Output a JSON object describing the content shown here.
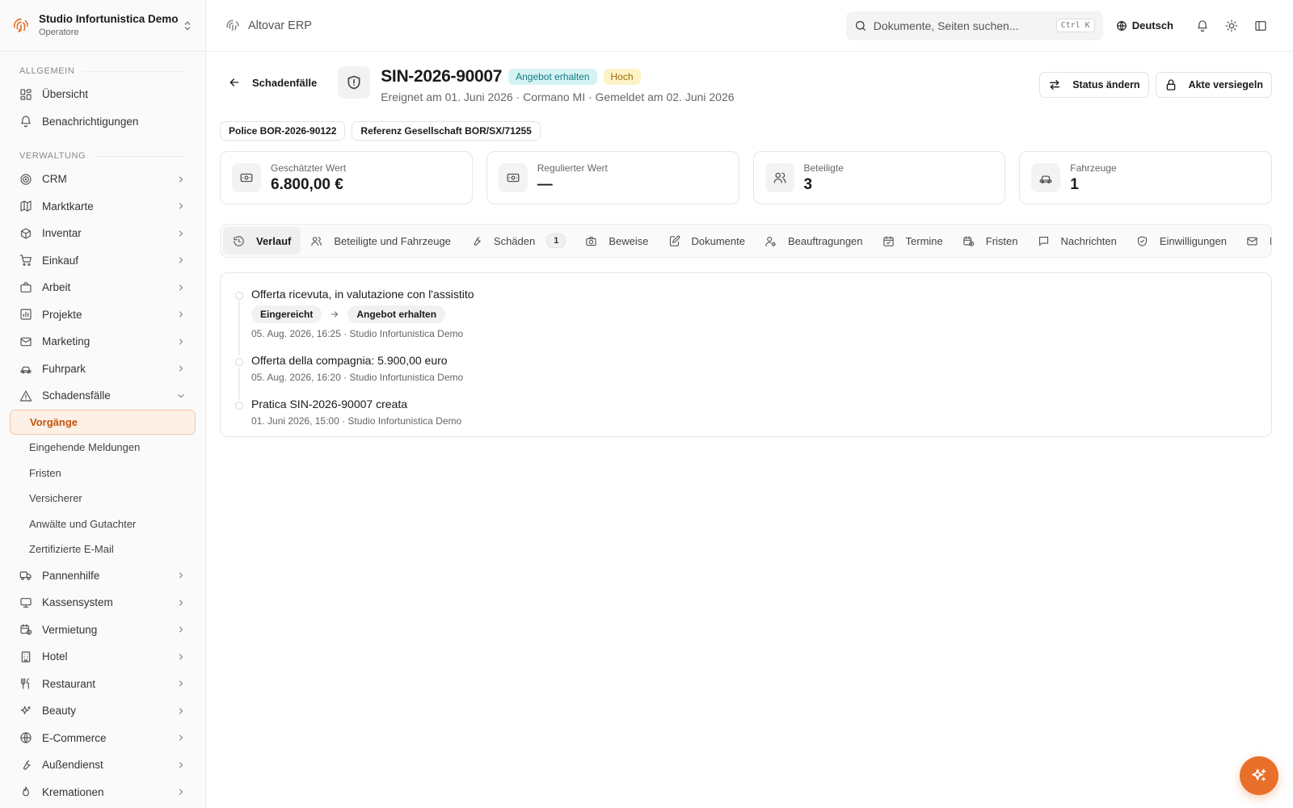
{
  "org": {
    "name": "Studio Infortunistica Demo",
    "role": "Operatore"
  },
  "sidebar": {
    "section_general": "ALLGEMEIN",
    "section_admin": "VERWALTUNG",
    "general_items": [
      {
        "label": "Übersicht",
        "icon": "dashboard-icon"
      },
      {
        "label": "Benachrichtigungen",
        "icon": "bell-icon"
      }
    ],
    "admin_items_top": [
      {
        "label": "CRM",
        "icon": "target-icon"
      },
      {
        "label": "Marktkarte",
        "icon": "map-icon"
      },
      {
        "label": "Inventar",
        "icon": "box-icon"
      },
      {
        "label": "Einkauf",
        "icon": "cart-icon"
      },
      {
        "label": "Arbeit",
        "icon": "briefcase-icon"
      },
      {
        "label": "Projekte",
        "icon": "chart-icon"
      },
      {
        "label": "Marketing",
        "icon": "mail-icon"
      },
      {
        "label": "Fuhrpark",
        "icon": "car-icon"
      }
    ],
    "claims": {
      "label": "Schadensfälle",
      "icon": "warning-icon"
    },
    "claims_sub": [
      "Vorgänge",
      "Eingehende Meldungen",
      "Fristen",
      "Versicherer",
      "Anwälte und Gutachter",
      "Zertifizierte E-Mail"
    ],
    "admin_items_bottom": [
      {
        "label": "Pannenhilfe",
        "icon": "truck-icon"
      },
      {
        "label": "Kassensystem",
        "icon": "monitor-icon"
      },
      {
        "label": "Vermietung",
        "icon": "calendar-clock-icon"
      },
      {
        "label": "Hotel",
        "icon": "building-icon"
      },
      {
        "label": "Restaurant",
        "icon": "utensils-icon"
      },
      {
        "label": "Beauty",
        "icon": "sparkle-icon"
      },
      {
        "label": "E-Commerce",
        "icon": "globe-icon"
      },
      {
        "label": "Außendienst",
        "icon": "wrench-icon"
      },
      {
        "label": "Kremationen",
        "icon": "flame-icon"
      }
    ]
  },
  "topbar": {
    "brand": "Altovar ERP",
    "search_placeholder": "Dokumente, Seiten suchen...",
    "search_shortcut": "Ctrl K",
    "language": "Deutsch"
  },
  "case": {
    "back_label": "Schadenfälle",
    "id": "SIN-2026-90007",
    "status": "Angebot erhalten",
    "priority": "Hoch",
    "subtitle": "Ereignet am 01. Juni 2026 · Cormano MI · Gemeldet am 02. Juni 2026",
    "actions": {
      "change_status": "Status ändern",
      "seal": "Akte versiegeln"
    },
    "refs": [
      "Police BOR-2026-90122",
      "Referenz Gesellschaft BOR/SX/71255"
    ]
  },
  "stats": [
    {
      "label": "Geschätzter Wert",
      "value": "6.800,00 €",
      "icon": "banknote-icon"
    },
    {
      "label": "Regulierter Wert",
      "value": "—",
      "icon": "banknote-icon"
    },
    {
      "label": "Beteiligte",
      "value": "3",
      "icon": "users-icon"
    },
    {
      "label": "Fahrzeuge",
      "value": "1",
      "icon": "car-icon"
    }
  ],
  "tabs": [
    {
      "label": "Verlauf",
      "icon": "history-icon"
    },
    {
      "label": "Beteiligte und Fahrzeuge",
      "icon": "users-icon"
    },
    {
      "label": "Schäden",
      "icon": "wrench-icon",
      "count": "1"
    },
    {
      "label": "Beweise",
      "icon": "camera-icon"
    },
    {
      "label": "Dokumente",
      "icon": "edit-icon"
    },
    {
      "label": "Beauftragungen",
      "icon": "user-gear-icon"
    },
    {
      "label": "Termine",
      "icon": "calendar-check-icon"
    },
    {
      "label": "Fristen",
      "icon": "calendar-clock-icon"
    },
    {
      "label": "Nachrichten",
      "icon": "message-icon"
    },
    {
      "label": "Einwilligungen",
      "icon": "shield-check-icon"
    },
    {
      "label": "P",
      "icon": "mail-icon"
    }
  ],
  "timeline": [
    {
      "title": "Offerta ricevuta, in valutazione con l'assistito",
      "from": "Eingereicht",
      "to": "Angebot erhalten",
      "meta": "05. Aug. 2026, 16:25 · Studio Infortunistica Demo"
    },
    {
      "title": "Offerta della compagnia: 5.900,00 euro",
      "meta": "05. Aug. 2026, 16:20 · Studio Infortunistica Demo"
    },
    {
      "title": "Pratica SIN-2026-90007 creata",
      "meta": "01. Juni 2026, 15:00 · Studio Infortunistica Demo"
    }
  ],
  "colors": {
    "accent": "#e8702a",
    "status_bg": "#d6f3f4",
    "status_fg": "#147a86",
    "priority_bg": "#fdf3c8",
    "priority_fg": "#9a6a05"
  }
}
